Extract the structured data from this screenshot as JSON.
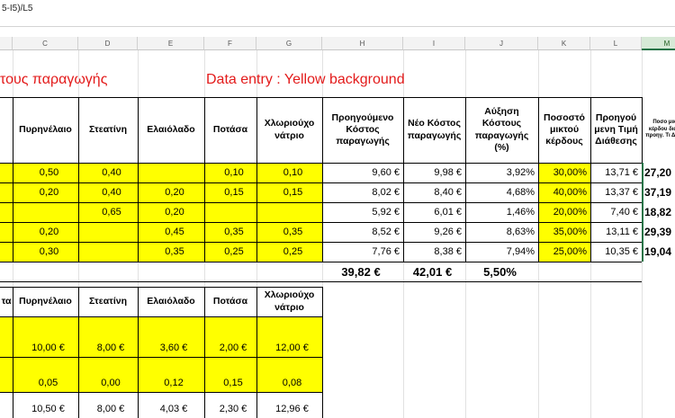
{
  "formula_bar": {
    "text": "5-I5)/L5"
  },
  "columns": [
    "C",
    "D",
    "E",
    "F",
    "G",
    "H",
    "I",
    "J",
    "K",
    "L",
    "M"
  ],
  "selected_column": "M",
  "titles": {
    "left_title": "τους παραγωγής",
    "data_entry": "Data entry : Yellow background"
  },
  "table1": {
    "headers": [
      "Πυρηνέλαιο",
      "Στεατίνη",
      "Ελαιόλαδο",
      "Ποτάσα",
      "Χλωριούχο νάτριο",
      "Προηγούμενο Κόστος παραγωγής",
      "Νέο Κόστος παραγωγής",
      "Αύξηση Κόστους παραγωγής (%)",
      "Ποσοστό μικτού κέρδους",
      "Προηγού μενη Τιμή Διάθεσης",
      "Ποσο μικτο κέρδου διατήρ προηγ. Τι Διάθεσ"
    ],
    "rows": [
      [
        "0,50",
        "0,40",
        "",
        "0,10",
        "0,10",
        "9,60 €",
        "9,98 €",
        "3,92%",
        "30,00%",
        "13,71 €",
        "27,20"
      ],
      [
        "0,20",
        "0,40",
        "0,20",
        "0,15",
        "0,15",
        "8,02 €",
        "8,40 €",
        "4,68%",
        "40,00%",
        "13,37 €",
        "37,19"
      ],
      [
        "",
        "0,65",
        "0,20",
        "",
        "",
        "5,92 €",
        "6,01 €",
        "1,46%",
        "20,00%",
        "7,40 €",
        "18,82"
      ],
      [
        "0,20",
        "",
        "0,45",
        "0,35",
        "0,35",
        "8,52 €",
        "9,26 €",
        "8,63%",
        "35,00%",
        "13,11 €",
        "29,39"
      ],
      [
        "0,30",
        "",
        "0,35",
        "0,25",
        "0,25",
        "7,76 €",
        "8,38 €",
        "7,94%",
        "25,00%",
        "10,35 €",
        "19,04"
      ]
    ],
    "totals": [
      "39,82 €",
      "42,01 €",
      "5,50%"
    ]
  },
  "table2": {
    "first_col_fragment": "τα",
    "headers": [
      "Πυρηνέλαιο",
      "Στεατίνη",
      "Ελαιόλαδο",
      "Ποτάσα",
      "Χλωριούχο νάτριο"
    ],
    "rows": [
      [
        "10,00 €",
        "8,00 €",
        "3,60 €",
        "2,00 €",
        "12,00 €"
      ],
      [
        "0,05",
        "0,00",
        "0,12",
        "0,15",
        "0,08"
      ],
      [
        "10,50 €",
        "8,00 €",
        "4,03 €",
        "2,30 €",
        "12,96 €"
      ]
    ]
  }
}
